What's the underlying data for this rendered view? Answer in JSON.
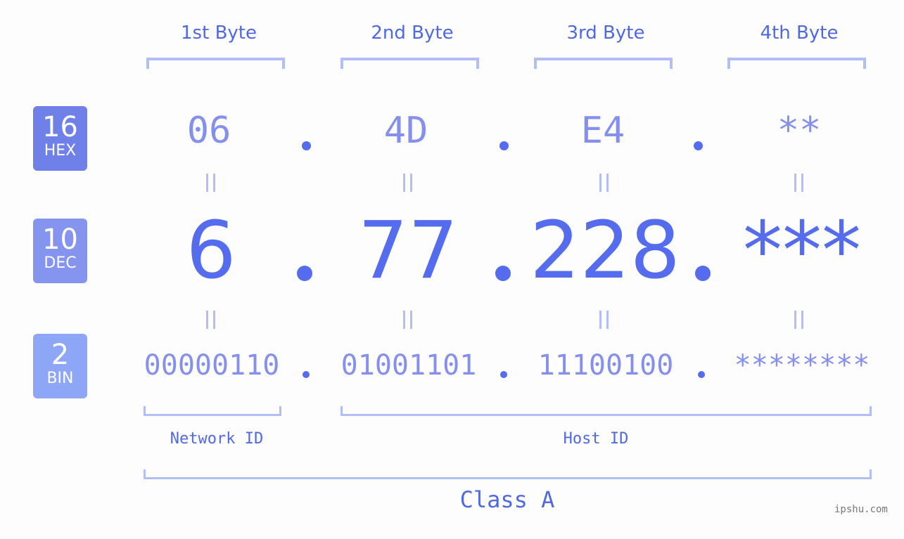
{
  "bases": [
    {
      "num": "16",
      "label": "HEX",
      "color": "#6f80e8"
    },
    {
      "num": "10",
      "label": "DEC",
      "color": "#8494ef"
    },
    {
      "num": "2",
      "label": "BIN",
      "color": "#8da6f5"
    }
  ],
  "byte_headers": [
    "1st Byte",
    "2nd Byte",
    "3rd Byte",
    "4th Byte"
  ],
  "hex": [
    "06",
    "4D",
    "E4",
    "**"
  ],
  "dec": [
    "6",
    "77",
    "228",
    "***"
  ],
  "bin": [
    "00000110",
    "01001101",
    "11100100",
    "********"
  ],
  "separator": ".",
  "network_label": "Network ID",
  "host_label": "Host ID",
  "class_label": "Class A",
  "watermark": "ipshu.com",
  "colors": {
    "accent": "#546ced",
    "light": "#8490ec",
    "bracket": "#b3bef5"
  }
}
